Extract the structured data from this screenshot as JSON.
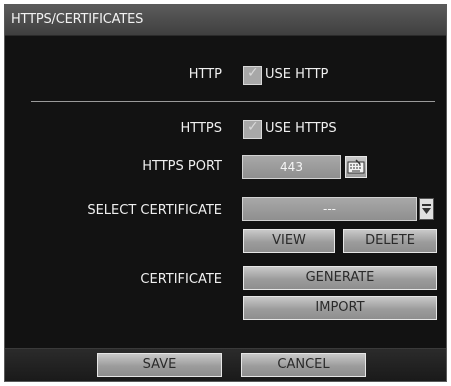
{
  "title": "HTTPS/CERTIFICATES",
  "http": {
    "label": "HTTP",
    "checkbox_label": "USE HTTP"
  },
  "https": {
    "label": "HTTPS",
    "checkbox_label": "USE HTTPS"
  },
  "https_port": {
    "label": "HTTPS PORT",
    "value": "443",
    "icon": "keyboard-icon"
  },
  "select_certificate": {
    "label": "SELECT CERTIFICATE",
    "value": "---",
    "icon": "dropdown-arrow-icon"
  },
  "certificate_actions": {
    "view": "VIEW",
    "delete": "DELETE"
  },
  "certificate": {
    "label": "CERTIFICATE",
    "generate": "GENERATE",
    "import": "IMPORT"
  },
  "footer": {
    "save": "SAVE",
    "cancel": "CANCEL"
  }
}
